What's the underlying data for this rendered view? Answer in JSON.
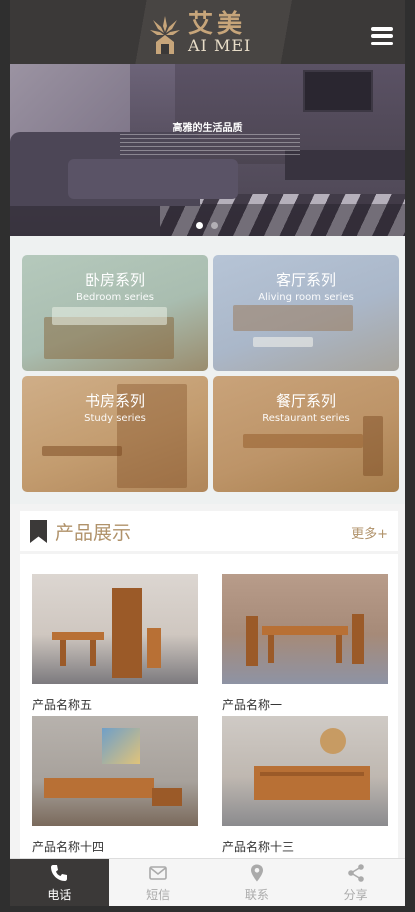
{
  "header": {
    "logo_cn": "艾美",
    "logo_en": "AI MEI",
    "menu_icon": "hamburger-menu-icon"
  },
  "banner": {
    "title": "高雅的生活品质",
    "slides": 2,
    "active_slide": 1
  },
  "categories": [
    {
      "cn": "卧房系列",
      "en": "Bedroom series"
    },
    {
      "cn": "客厅系列",
      "en": "Aliving room series"
    },
    {
      "cn": "书房系列",
      "en": "Study series"
    },
    {
      "cn": "餐厅系列",
      "en": "Restaurant series"
    }
  ],
  "products": {
    "title": "产品展示",
    "more": "更多+",
    "items": [
      {
        "name": "产品名称五"
      },
      {
        "name": "产品名称一"
      },
      {
        "name": "产品名称十四"
      },
      {
        "name": "产品名称十三"
      }
    ]
  },
  "bottom_nav": [
    {
      "label": "电话",
      "icon": "phone-icon",
      "active": true
    },
    {
      "label": "短信",
      "icon": "message-icon",
      "active": false
    },
    {
      "label": "联系",
      "icon": "location-icon",
      "active": false
    },
    {
      "label": "分享",
      "icon": "share-icon",
      "active": false
    }
  ],
  "colors": {
    "header_bg": "#3b3938",
    "accent_gold": "#b0926a",
    "logo_gold": "#c7a57a"
  }
}
